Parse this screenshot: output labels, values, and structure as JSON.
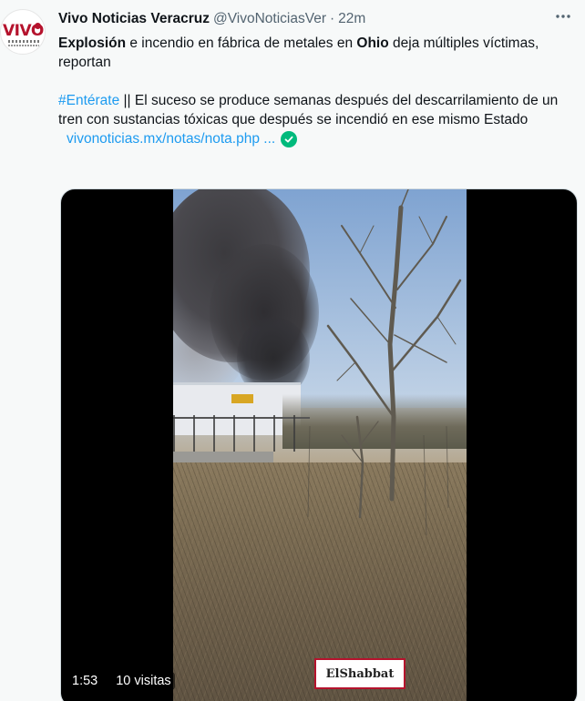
{
  "author": {
    "name": "Vivo Noticias Veracruz",
    "handle": "@VivoNoticiasVer",
    "separator": "·",
    "time": "22m",
    "avatar_logo": "VIVO"
  },
  "more_icon": "more-horizontal-icon",
  "tweet": {
    "line1_bold_start": "Explosión",
    "line1_mid": " e incendio en fábrica de metales en ",
    "line1_bold_ohio": "Ohio",
    "line1_end": " deja múltiples víctimas, reportan",
    "hashtag": "#Entérate",
    "para2": " || El suceso se produce semanas después del descarrilamiento de un tren con sustancias tóxicas que después se incendió en ese mismo Estado",
    "link": "vivonoticias.mx/notas/nota.php ...",
    "link_badge_icon": "check-circle-icon"
  },
  "video": {
    "duration": "1:53",
    "views": "10 visitas",
    "watermark": "ElShabbat"
  },
  "colors": {
    "accent": "#1d9bf0",
    "check": "#00ba7c",
    "brand": "#b5132d"
  }
}
